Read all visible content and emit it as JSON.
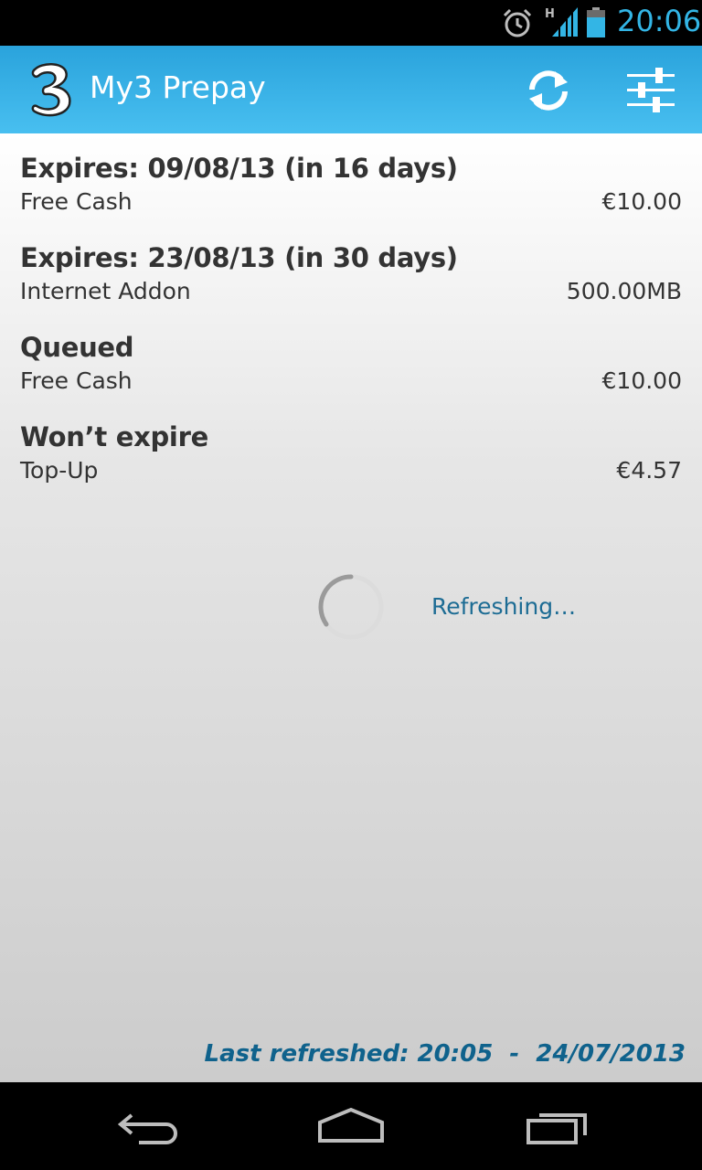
{
  "status_bar": {
    "time": "20:06",
    "network_type": "H",
    "icons": [
      "alarm-icon",
      "signal-icon",
      "battery-icon"
    ]
  },
  "action_bar": {
    "title": "My3 Prepay",
    "logo": "three-logo",
    "actions": [
      "refresh-icon",
      "settings-sliders-icon"
    ]
  },
  "balances": [
    {
      "heading": "Expires: 09/08/13 (in 16 days)",
      "label": "Free Cash",
      "value": "€10.00"
    },
    {
      "heading": "Expires: 23/08/13 (in 30 days)",
      "label": "Internet Addon",
      "value": "500.00MB"
    },
    {
      "heading": "Queued",
      "label": "Free Cash",
      "value": "€10.00"
    },
    {
      "heading": "Won’t expire",
      "label": "Top-Up",
      "value": "€4.57"
    }
  ],
  "loading": {
    "text": "Refreshing…"
  },
  "footer": {
    "last_refreshed": "Last refreshed: 20:05  -  24/07/2013"
  },
  "nav_bar": {
    "buttons": [
      "back-icon",
      "home-icon",
      "recent-apps-icon"
    ]
  },
  "colors": {
    "accent": "#33b5e5",
    "action_bar": "#2aa3dc",
    "text_dark": "#333333",
    "link_blue": "#1d6c94"
  }
}
